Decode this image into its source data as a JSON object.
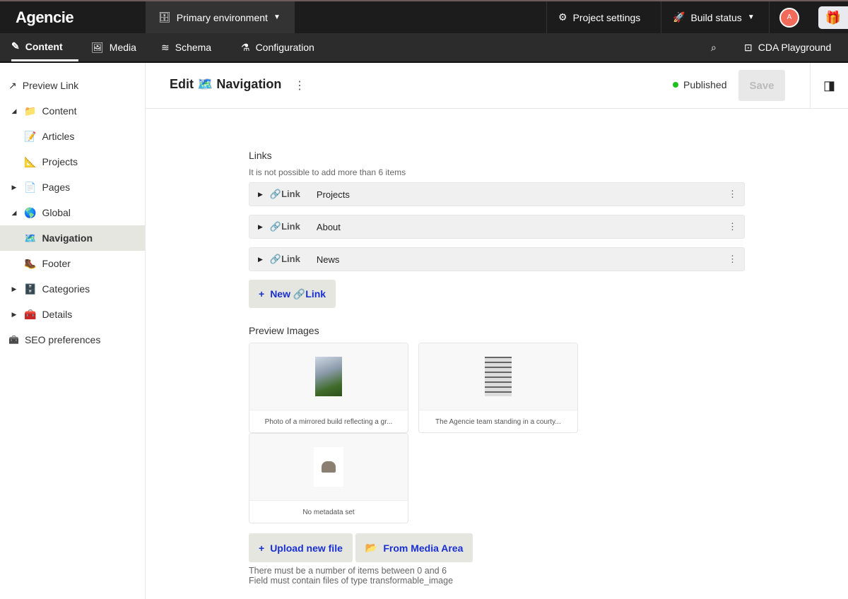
{
  "app": {
    "logo": "Agencie",
    "environment": "Primary environment",
    "project_settings": "Project settings",
    "build_status": "Build status",
    "avatar": "A"
  },
  "tabs": [
    {
      "label": "Content"
    },
    {
      "label": "Media"
    },
    {
      "label": "Schema"
    },
    {
      "label": "Configuration"
    }
  ],
  "cda": "CDA Playground",
  "sidebar": [
    {
      "label": "Preview Link",
      "icon": "🔗"
    },
    {
      "label": "Content",
      "icon": "📁"
    },
    {
      "label": "Articles",
      "icon": "📝"
    },
    {
      "label": "Projects",
      "icon": "📐"
    },
    {
      "label": "Pages",
      "icon": "📄"
    },
    {
      "label": "Global",
      "icon": "🌎"
    },
    {
      "label": "Navigation",
      "icon": "🗺️"
    },
    {
      "label": "Footer",
      "icon": "🥾"
    },
    {
      "label": "Categories",
      "icon": "🗄️"
    },
    {
      "label": "Details",
      "icon": "🧰"
    },
    {
      "label": "SEO preferences",
      "icon": "🧰"
    }
  ],
  "header": {
    "title": "Edit 🗺️ Navigation",
    "status": "Published",
    "save": "Save"
  },
  "links": {
    "label": "Links",
    "hint": "It is not possible to add more than 6 items",
    "type": "🔗Link",
    "items": [
      "Projects",
      "About",
      "News"
    ],
    "new_button": "New 🔗Link"
  },
  "images": {
    "label": "Preview Images",
    "items": [
      "Photo of a mirrored build reflecting a gr...",
      "The Agencie team standing in a courty...",
      "No metadata set"
    ],
    "upload": "Upload new file",
    "from_media": "From Media Area",
    "hint1": "There must be a number of items between 0 and 6",
    "hint2": "Field must contain files of type transformable_image"
  }
}
